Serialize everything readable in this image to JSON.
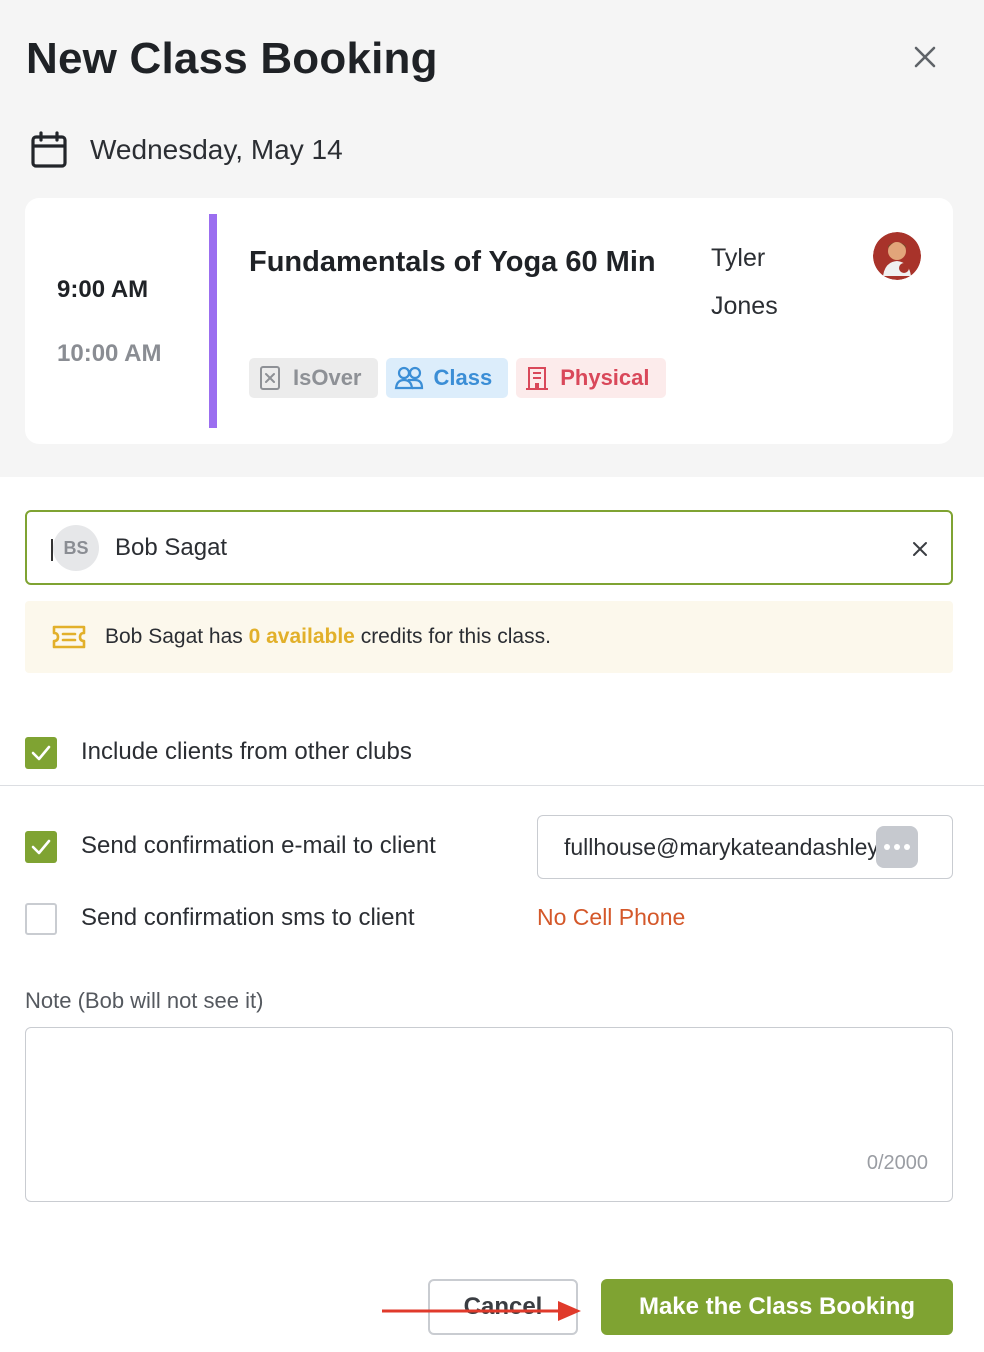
{
  "dialog": {
    "title": "New Class Booking"
  },
  "date": {
    "label": "Wednesday, May 14"
  },
  "class_card": {
    "start_time": "9:00 AM",
    "end_time": "10:00 AM",
    "name": "Fundamentals of Yoga 60 Min",
    "instructor": "Tyler Jones",
    "tags": [
      {
        "label": "IsOver",
        "icon": "x-square-icon"
      },
      {
        "label": "Class",
        "icon": "group-icon"
      },
      {
        "label": "Physical",
        "icon": "building-icon"
      }
    ],
    "accent_color": "#9b6ef0"
  },
  "client": {
    "initials": "BS",
    "name": "Bob Sagat"
  },
  "credits": {
    "prefix": "Bob Sagat has ",
    "highlight": "0 available",
    "suffix": " credits for this class."
  },
  "options": {
    "include_other_clubs": {
      "label": "Include clients from other clubs",
      "checked": true
    },
    "send_email": {
      "label": "Send confirmation e-mail to client",
      "checked": true
    },
    "send_sms": {
      "label": "Send confirmation sms to client",
      "checked": false
    }
  },
  "email": {
    "value": "fullhouse@marykateandashley.co"
  },
  "sms": {
    "status": "No Cell Phone"
  },
  "note": {
    "label": "Note (Bob will not see it)",
    "counter": "0/2000"
  },
  "actions": {
    "cancel": "Cancel",
    "submit": "Make the Class Booking"
  },
  "colors": {
    "primary": "#7fa332",
    "header_bg": "#f5f5f5",
    "highlight": "#e2b02a",
    "warning": "#d4582a",
    "arrow": "#e03a2b"
  }
}
